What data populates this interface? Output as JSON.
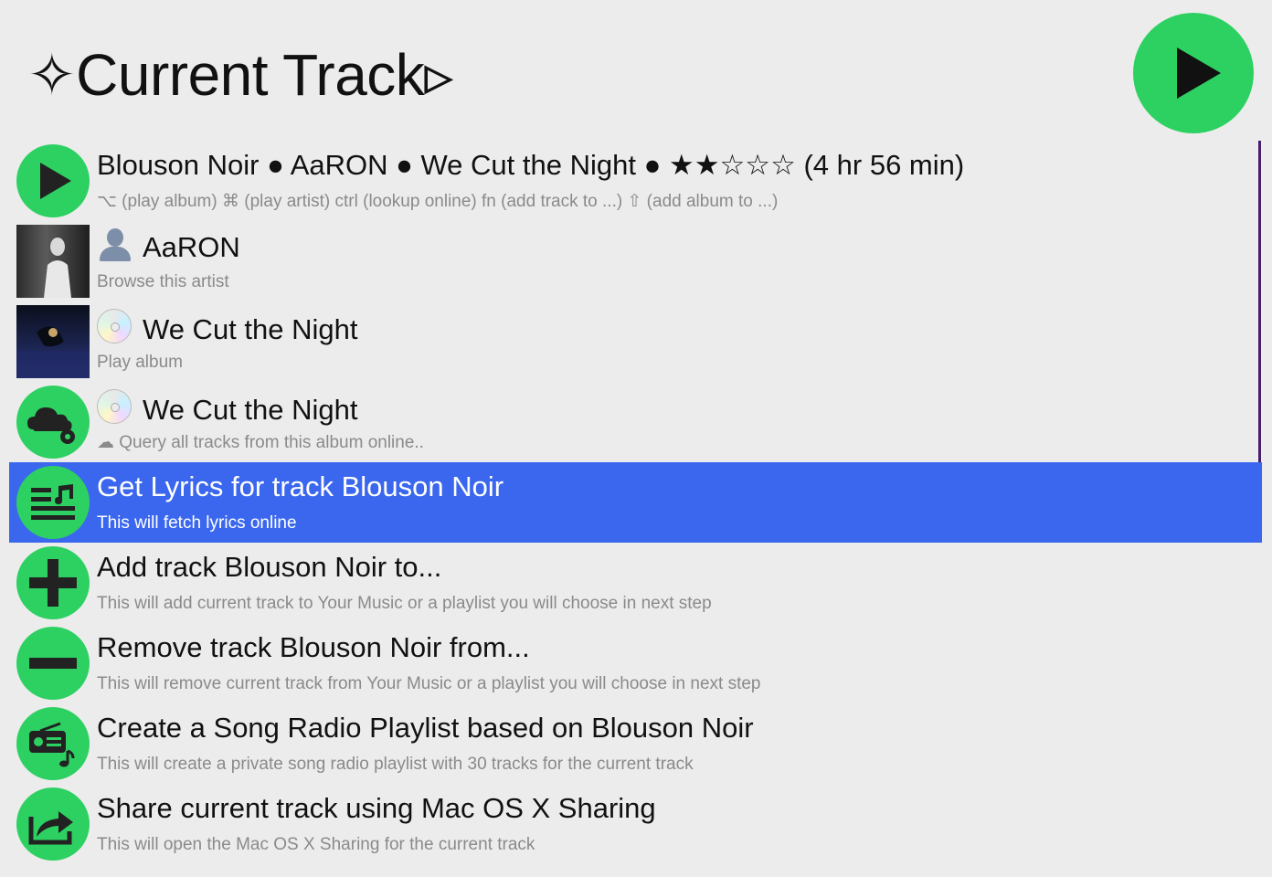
{
  "header": {
    "title": "✧Current Track▹",
    "play_icon": "play-icon"
  },
  "colors": {
    "background": "#ececec",
    "accent_green": "#2dd162",
    "selection": "#3a67ee",
    "subtitle_gray": "#8a8a8a"
  },
  "rows": [
    {
      "main": "Blouson Noir ● AaRON ● We Cut the Night ● ★★☆☆☆ (4 hr 56 min)",
      "sub": "⌥ (play album) ⌘ (play artist) ctrl (lookup online) fn (add track to ...) ⇧ (add album to ...)",
      "icon": "play-icon"
    },
    {
      "main": "AaRON",
      "sub": "Browse this artist",
      "icon": "artist-thumbnail"
    },
    {
      "main": "We Cut the Night",
      "sub": "Play album",
      "icon": "album-cover-thumbnail"
    },
    {
      "main": "We Cut the Night",
      "sub": "☁ Query all tracks from this album online..",
      "icon": "cloud-icon"
    },
    {
      "main": "Get Lyrics for track Blouson Noir",
      "sub": "This will fetch lyrics online",
      "icon": "lyrics-icon",
      "selected": true
    },
    {
      "main": "Add track Blouson Noir to...",
      "sub": "This will add current track to Your Music or a playlist you will choose in next step",
      "icon": "plus-icon"
    },
    {
      "main": "Remove track Blouson Noir from...",
      "sub": "This will remove current track from Your Music or a playlist you will choose in next step",
      "icon": "minus-icon"
    },
    {
      "main": "Create a Song Radio Playlist based on Blouson Noir",
      "sub": "This will create a private song radio playlist with 30 tracks for the current track",
      "icon": "radio-icon"
    },
    {
      "main": "Share current track using Mac OS X Sharing",
      "sub": "This will open the Mac OS X Sharing for the current track",
      "icon": "share-icon"
    }
  ]
}
